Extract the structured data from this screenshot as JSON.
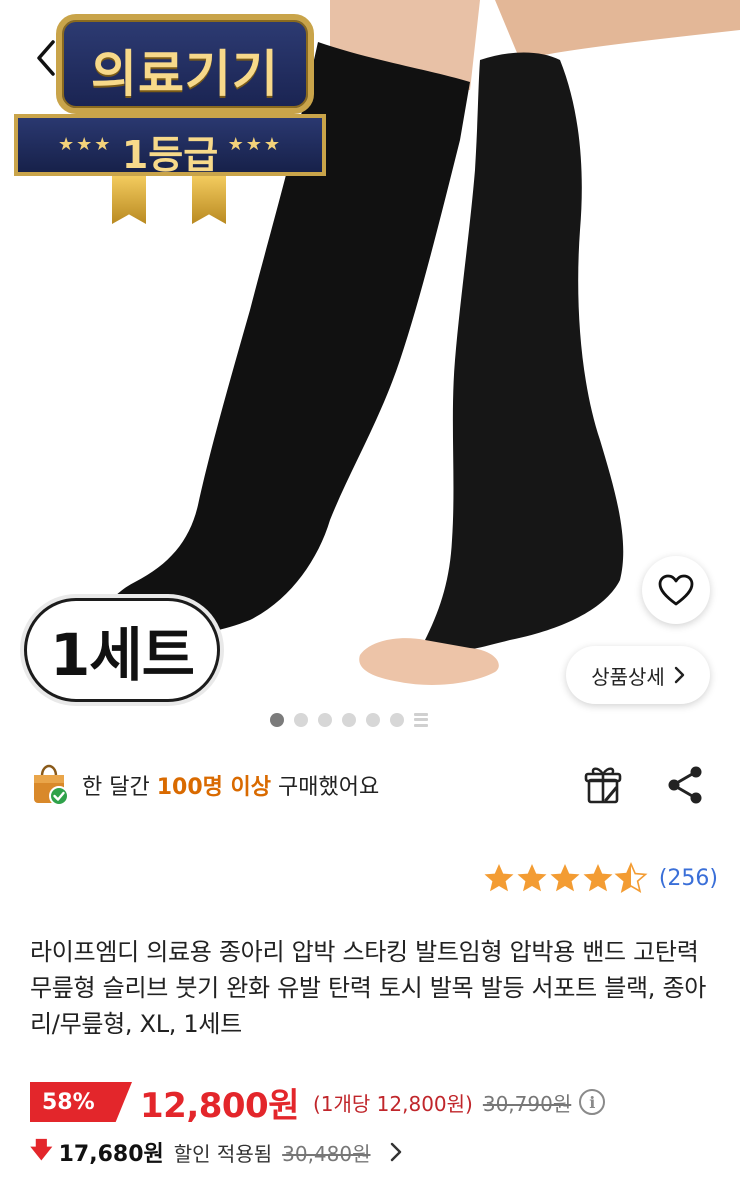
{
  "badge": {
    "top_text": "의료기기",
    "rank_text": "1등급",
    "stars_left": "★★★",
    "stars_right": "★★★"
  },
  "set_label": "1세트",
  "detail_button": "상품상세",
  "carousel": {
    "total": 7,
    "active_index": 1
  },
  "purchase": {
    "prefix": "한 달간 ",
    "highlight": "100명 이상",
    "suffix": " 구매했어요"
  },
  "rating": {
    "stars": 4.5,
    "count": "(256)"
  },
  "title": "라이프엠디 의료용 종아리 압박 스타킹 발트임형 압박용 밴드 고탄력 무릎형 슬리브 붓기 완화 유발 탄력 토시 발목 발등 서포트 블랙, 종아리/무릎형, XL, 1세트",
  "price": {
    "discount": "58%",
    "sale": "12,800원",
    "unit": "(1개당 12,800원)",
    "original": "30,790원"
  },
  "coupon": {
    "price": "17,680원",
    "label": "할인 적용됨",
    "original": "30,480원"
  },
  "colors": {
    "accent_red": "#e3262b",
    "orange": "#d96a00",
    "link_blue": "#3a6fd8",
    "badge_navy": "#1a2452",
    "badge_gold": "#c9a44a"
  }
}
